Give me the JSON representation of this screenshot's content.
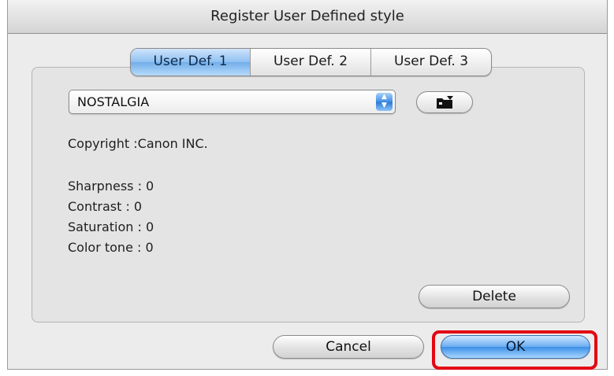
{
  "window": {
    "title": "Register User Defined style"
  },
  "tabs": [
    {
      "label": "User Def. 1",
      "selected": true
    },
    {
      "label": "User Def. 2",
      "selected": false
    },
    {
      "label": "User Def. 3",
      "selected": false
    }
  ],
  "style_popup": {
    "value": "NOSTALGIA",
    "icon": "up-down-arrows-icon"
  },
  "open_file_button": {
    "icon": "folder-open-icon"
  },
  "info": {
    "copyright": "Copyright :Canon INC.",
    "sharpness": "Sharpness : 0",
    "contrast": "Contrast : 0",
    "saturation": "Saturation : 0",
    "color_tone": "Color tone : 0"
  },
  "buttons": {
    "delete": "Delete",
    "cancel": "Cancel",
    "ok": "OK"
  },
  "colors": {
    "highlight": "#e30613",
    "accent": "#3d8fe6"
  }
}
